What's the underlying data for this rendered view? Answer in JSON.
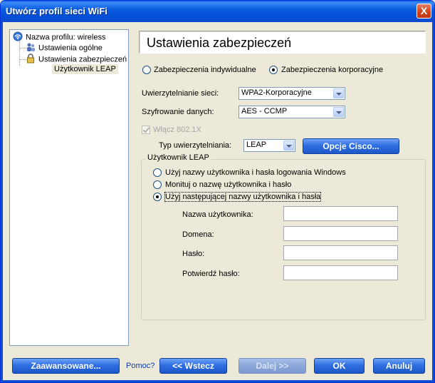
{
  "window": {
    "title": "Utwórz profil sieci WiFi",
    "close_label": "X"
  },
  "tree": {
    "root": "Nazwa profilu: wireless",
    "general": "Ustawienia ogólne",
    "security": "Ustawienia zabezpieczeń",
    "leaf": "Użytkownik LEAP"
  },
  "header": {
    "title": "Ustawienia zabezpieczeń"
  },
  "security_type": {
    "individual": "Zabezpieczenia indywidualne",
    "enterprise": "Zabezpieczenia korporacyjne"
  },
  "auth": {
    "label": "Uwierzytelnianie sieci:",
    "value": "WPA2-Korporacyjne"
  },
  "encryption": {
    "label": "Szyfrowanie danych:",
    "value": "AES - CCMP"
  },
  "enable_8021x": "Włącz 802.1X",
  "auth_type": {
    "label": "Typ uwierzytelniania:",
    "value": "LEAP"
  },
  "cisco_button": "Opcje Cisco...",
  "leap_group": {
    "title": "Użytkownik LEAP",
    "option_windows": "Użyj nazwy użytkownika i hasła logowania Windows",
    "option_prompt": "Monituj o nazwę użytkownika i hasło",
    "option_following": "Użyj następującej nazwy użytkownika i hasła",
    "username_label": "Nazwa użytkownika:",
    "domain_label": "Domena:",
    "password_label": "Hasło:",
    "confirm_label": "Potwierdź hasło:",
    "username_value": "",
    "domain_value": "",
    "password_value": "",
    "confirm_value": ""
  },
  "footer": {
    "advanced": "Zaawansowane...",
    "help": "Pomoc?",
    "back": "<< Wstecz",
    "next": "Dalej >>",
    "ok": "OK",
    "cancel": "Anuluj"
  }
}
